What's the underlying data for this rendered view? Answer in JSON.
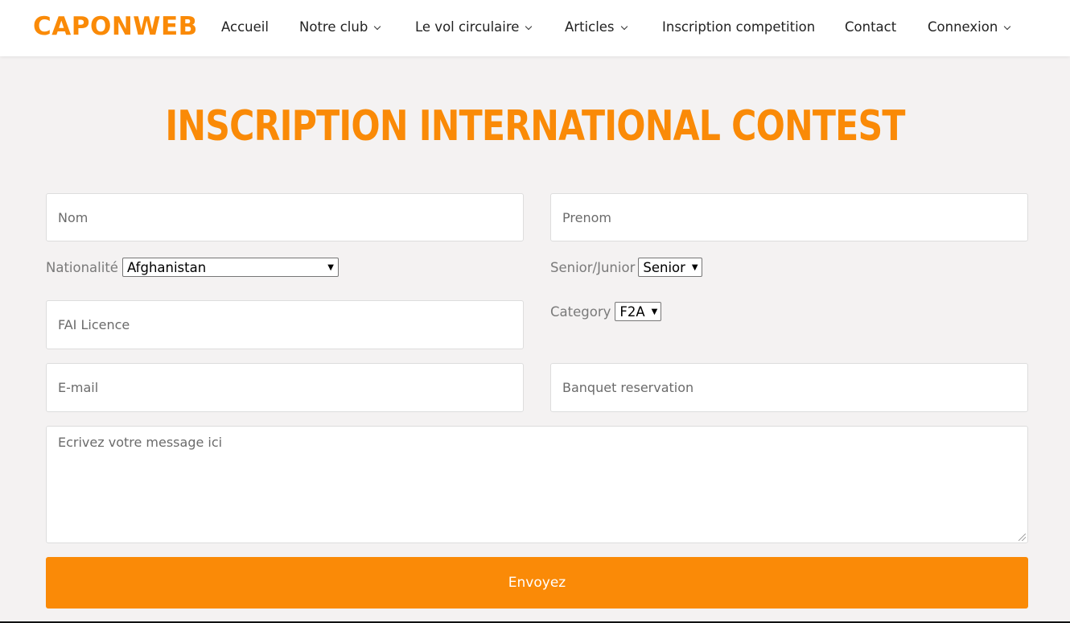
{
  "header": {
    "logo": "CAPONWEB",
    "nav": [
      {
        "label": "Accueil"
      },
      {
        "label": "Notre club"
      },
      {
        "label": "Le vol circulaire"
      },
      {
        "label": "Articles"
      },
      {
        "label": "Inscription competition"
      },
      {
        "label": "Contact"
      },
      {
        "label": "Connexion"
      }
    ]
  },
  "main": {
    "title": "INSCRIPTION INTERNATIONAL CONTEST",
    "form": {
      "nom_placeholder": "Nom",
      "prenom_placeholder": "Prenom",
      "nationalite_label": "Nationalité",
      "nationalite_value": "Afghanistan",
      "senior_junior_label": "Senior/Junior",
      "senior_junior_value": "Senior",
      "fai_placeholder": "FAI Licence",
      "category_label": "Category",
      "category_value": "F2A",
      "email_placeholder": "E-mail",
      "banquet_placeholder": "Banquet reservation",
      "message_placeholder": "Ecrivez votre message ici",
      "submit_label": "Envoyez"
    }
  },
  "colors": {
    "accent": "#fa8a07",
    "background": "#f4f2f2"
  }
}
